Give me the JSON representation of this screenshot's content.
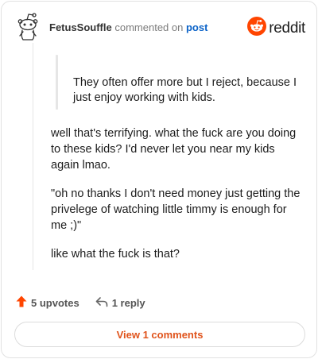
{
  "header": {
    "username": "FetusSouffle",
    "action_text": "commented on",
    "post_link": "post",
    "brand": "reddit"
  },
  "quote": {
    "text": "They often offer more but I reject, because I just enjoy working with kids."
  },
  "comment": {
    "paragraphs": [
      "well that's terrifying. what the fuck are you doing to these kids? I'd never let you near my kids again lmao.",
      "\"oh no thanks I don't need money just getting the privelege of watching little timmy is enough for me ;)\"",
      "like what the fuck is that?"
    ]
  },
  "actions": {
    "upvotes": "5 upvotes",
    "replies": "1 reply"
  },
  "view_comments": "View 1 comments",
  "colors": {
    "accent_orange": "#FF4500",
    "link_blue": "#0b63c8",
    "button_text": "#e0531b"
  },
  "icons": {
    "avatar": "snoo-avatar-icon",
    "logo": "reddit-logo-icon",
    "upvote": "upvote-arrow-icon",
    "reply": "reply-arrow-icon"
  }
}
